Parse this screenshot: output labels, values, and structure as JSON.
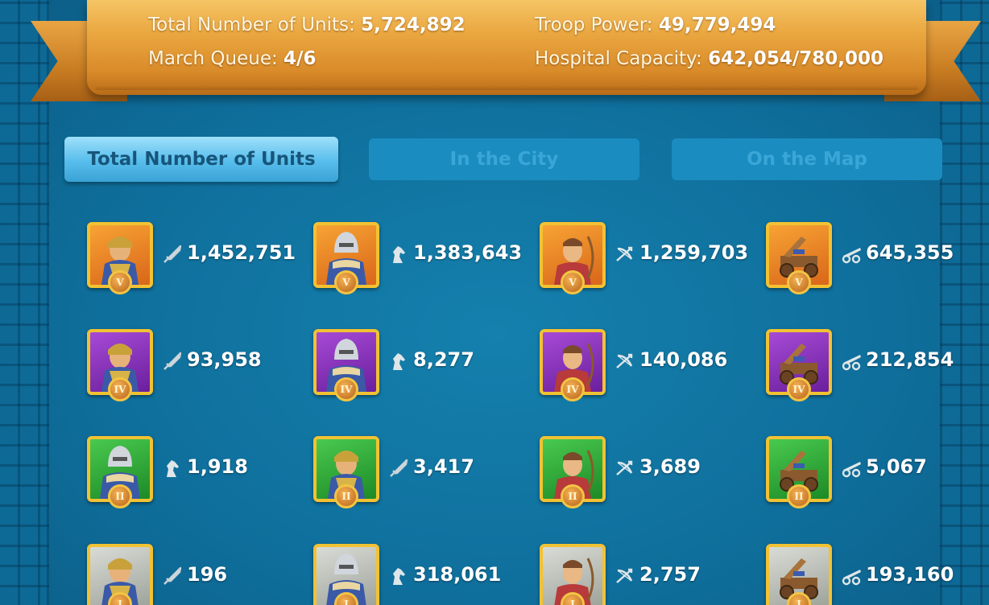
{
  "summary": {
    "total_units_label": "Total Number of Units:",
    "total_units_value": "5,724,892",
    "troop_power_label": "Troop Power:",
    "troop_power_value": "49,779,494",
    "march_queue_label": "March Queue:",
    "march_queue_value": "4/6",
    "hospital_label": "Hospital Capacity:",
    "hospital_value": "642,054/780,000"
  },
  "tabs": [
    {
      "label": "Total Number of Units",
      "active": true
    },
    {
      "label": "In the City",
      "active": false
    },
    {
      "label": "On the Map",
      "active": false
    }
  ],
  "units": [
    [
      {
        "tier": "V",
        "type": "infantry",
        "count": "1,452,751"
      },
      {
        "tier": "V",
        "type": "cavalry",
        "count": "1,383,643"
      },
      {
        "tier": "V",
        "type": "archer",
        "count": "1,259,703"
      },
      {
        "tier": "V",
        "type": "siege",
        "count": "645,355"
      }
    ],
    [
      {
        "tier": "IV",
        "type": "infantry",
        "count": "93,958"
      },
      {
        "tier": "IV",
        "type": "cavalry",
        "count": "8,277"
      },
      {
        "tier": "IV",
        "type": "archer",
        "count": "140,086"
      },
      {
        "tier": "IV",
        "type": "siege",
        "count": "212,854"
      }
    ],
    [
      {
        "tier": "II",
        "type": "cavalry",
        "count": "1,918"
      },
      {
        "tier": "II",
        "type": "infantry",
        "count": "3,417"
      },
      {
        "tier": "II",
        "type": "archer",
        "count": "3,689"
      },
      {
        "tier": "II",
        "type": "siege",
        "count": "5,067"
      }
    ],
    [
      {
        "tier": "I",
        "type": "infantry",
        "count": "196"
      },
      {
        "tier": "I",
        "type": "cavalry",
        "count": "318,061"
      },
      {
        "tier": "I",
        "type": "archer",
        "count": "2,757"
      },
      {
        "tier": "I",
        "type": "siege",
        "count": "193,160"
      }
    ]
  ],
  "icons": {
    "infantry": "sword-icon",
    "cavalry": "horse-head-icon",
    "archer": "bow-icon",
    "siege": "siege-engine-icon"
  }
}
